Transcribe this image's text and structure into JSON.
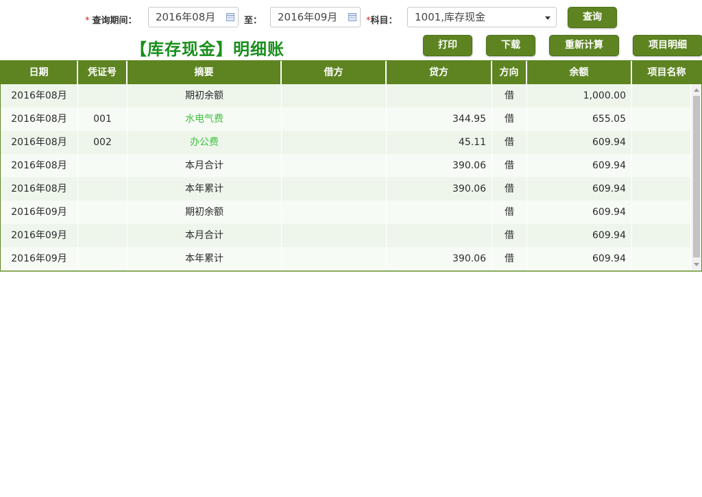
{
  "query": {
    "period_label": "查询期间：",
    "to_label": "至：",
    "subject_label": "科目：",
    "required_mark": "*",
    "start_period": "2016年08月",
    "end_period": "2016年09月",
    "subject_value": "1001,库存现金",
    "search_label": "查询"
  },
  "toolbar": {
    "print_label": "打印",
    "download_label": "下载",
    "recalc_label": "重新计算",
    "project_detail_label": "项目明细"
  },
  "page_title": "【库存现金】明细账",
  "table": {
    "columns": [
      "日期",
      "凭证号",
      "摘要",
      "借方",
      "贷方",
      "方向",
      "余额",
      "项目名称"
    ],
    "rows": [
      {
        "date": "2016年08月",
        "voucher": "",
        "summary": "期初余额",
        "debit": "",
        "credit": "",
        "direction": "借",
        "balance": "1,000.00",
        "project": ""
      },
      {
        "date": "2016年08月",
        "voucher": "001",
        "summary": "水电气费",
        "debit": "",
        "credit": "344.95",
        "direction": "借",
        "balance": "655.05",
        "project": ""
      },
      {
        "date": "2016年08月",
        "voucher": "002",
        "summary": "办公费",
        "debit": "",
        "credit": "45.11",
        "direction": "借",
        "balance": "609.94",
        "project": ""
      },
      {
        "date": "2016年08月",
        "voucher": "",
        "summary": "本月合计",
        "debit": "",
        "credit": "390.06",
        "direction": "借",
        "balance": "609.94",
        "project": ""
      },
      {
        "date": "2016年08月",
        "voucher": "",
        "summary": "本年累计",
        "debit": "",
        "credit": "390.06",
        "direction": "借",
        "balance": "609.94",
        "project": ""
      },
      {
        "date": "2016年09月",
        "voucher": "",
        "summary": "期初余额",
        "debit": "",
        "credit": "",
        "direction": "借",
        "balance": "609.94",
        "project": ""
      },
      {
        "date": "2016年09月",
        "voucher": "",
        "summary": "本月合计",
        "debit": "",
        "credit": "",
        "direction": "借",
        "balance": "609.94",
        "project": ""
      },
      {
        "date": "2016年09月",
        "voucher": "",
        "summary": "本年累计",
        "debit": "",
        "credit": "390.06",
        "direction": "借",
        "balance": "609.94",
        "project": ""
      }
    ]
  },
  "colors": {
    "accent": "#5d8421",
    "title": "#198f1c",
    "link": "#3fbf3f",
    "required": "#d02020"
  },
  "icons": [
    "calendar-icon",
    "calendar-icon",
    "dropdown-caret-icon"
  ]
}
